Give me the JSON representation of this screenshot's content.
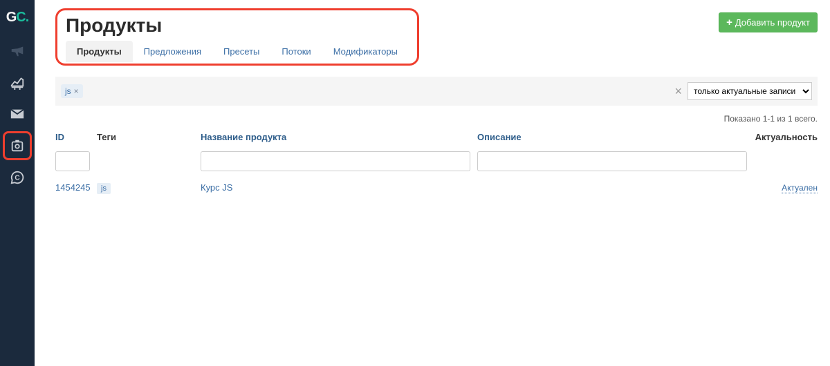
{
  "logo": {
    "g": "G",
    "c": "C",
    "dot": "."
  },
  "sidebar": {
    "items": [
      {
        "name": "megaphone-icon"
      },
      {
        "name": "chart-icon"
      },
      {
        "name": "mail-icon"
      },
      {
        "name": "products-icon"
      },
      {
        "name": "chat-icon"
      }
    ]
  },
  "page": {
    "title": "Продукты",
    "add_button": "Добавить продукт"
  },
  "tabs": [
    {
      "label": "Продукты",
      "active": true
    },
    {
      "label": "Предложения",
      "active": false
    },
    {
      "label": "Пресеты",
      "active": false
    },
    {
      "label": "Потоки",
      "active": false
    },
    {
      "label": "Модификаторы",
      "active": false
    }
  ],
  "filter": {
    "tag": "js",
    "select_value": "только актуальные записи",
    "clear_symbol": "×",
    "tag_close": "×"
  },
  "summary": "Показано 1-1 из 1 всего.",
  "columns": {
    "id": "ID",
    "tags": "Теги",
    "name": "Название продукта",
    "desc": "Описание",
    "actual": "Актуальность"
  },
  "rows": [
    {
      "id": "1454245",
      "tag": "js",
      "name": "Курс JS",
      "description": "",
      "actual_label": "Актуален"
    }
  ]
}
